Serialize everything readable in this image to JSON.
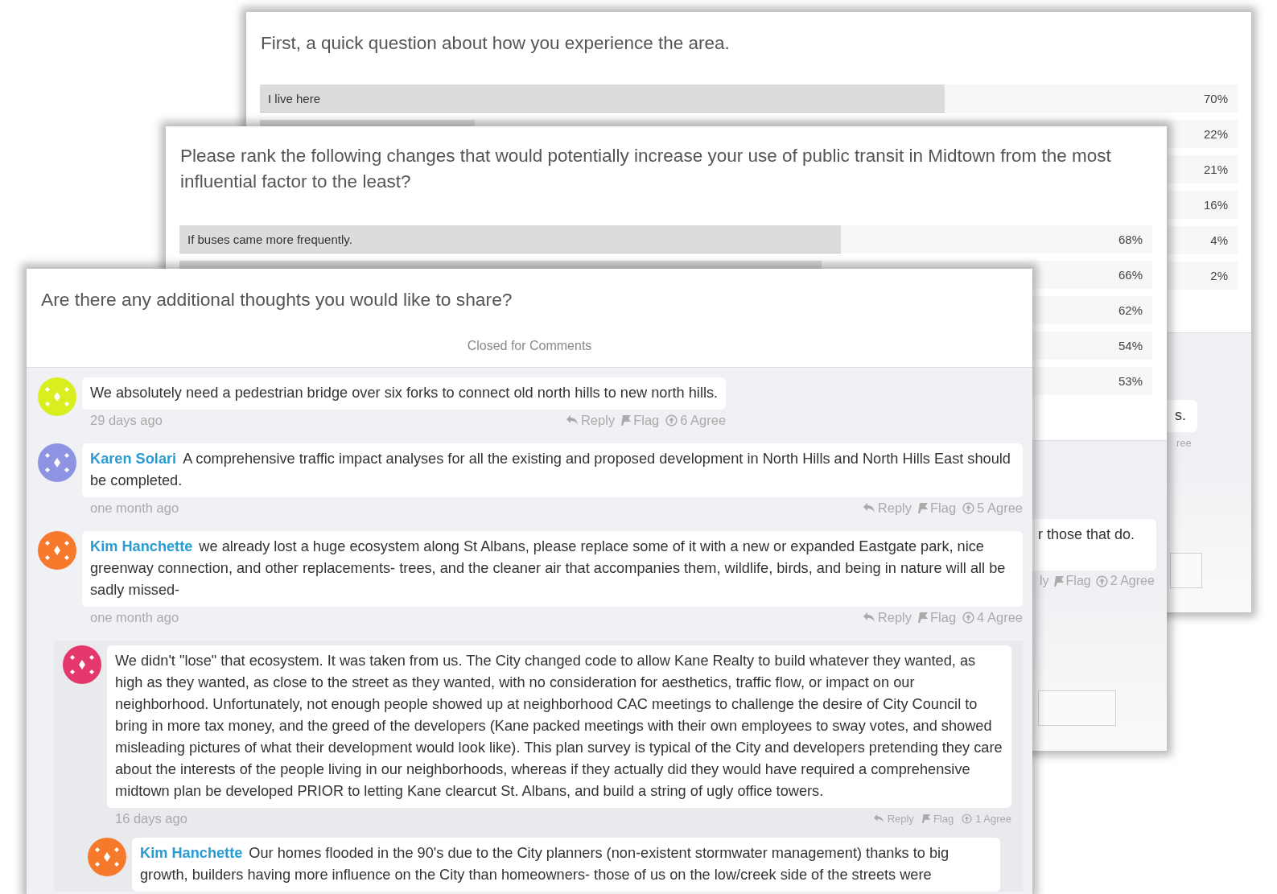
{
  "back_poll_card": {
    "question": "First, a quick question about how you experience the area.",
    "results": [
      {
        "label": "I live here",
        "level": 0.7,
        "percent": "70%"
      },
      {
        "level": 0.22,
        "percent": "22%"
      },
      {
        "percent": "21%"
      },
      {
        "percent": "16%"
      },
      {
        "percent": "4%"
      },
      {
        "percent": "2%"
      }
    ],
    "comment_fragment": {
      "text": "s.",
      "meta": "ree"
    }
  },
  "ranking_poll_card": {
    "question": "Please rank the following changes that would potentially increase your use of public transit in Midtown from the most influential factor to the least?",
    "results": [
      {
        "label": "If buses came more frequently.",
        "level": 0.68,
        "percent": "68%"
      },
      {
        "level": 0.66,
        "percent": "66%"
      },
      {
        "percent": "62%"
      },
      {
        "percent": "54%"
      },
      {
        "percent": "53%"
      }
    ],
    "comment_fragment": {
      "text": "r those that do.",
      "actions": [
        {
          "kind": "cut",
          "label": "ly"
        },
        {
          "kind": "flag",
          "label": "Flag"
        },
        {
          "kind": "agree",
          "label": "2 Agree"
        }
      ]
    }
  },
  "comments_card": {
    "question": "Are there any additional thoughts you would like to share?",
    "status": "Closed for Comments",
    "comments": [
      {
        "avatar": {
          "color": "#d9ee1f"
        },
        "text": "We absolutely need a pedestrian bridge over six forks to connect old north hills to new north hills.",
        "time": "29 days ago",
        "actions": [
          {
            "kind": "reply",
            "label": "Reply"
          },
          {
            "kind": "flag",
            "label": "Flag"
          },
          {
            "kind": "agree",
            "label": "6 Agree"
          }
        ]
      },
      {
        "avatar": {
          "color": "#8e93e2"
        },
        "author": "Karen Solari",
        "text": "A comprehensive traffic impact analyses for all the existing and proposed development in North Hills and North Hills East should be completed.",
        "time": "one month ago",
        "actions": [
          {
            "kind": "reply",
            "label": "Reply"
          },
          {
            "kind": "flag",
            "label": "Flag"
          },
          {
            "kind": "agree",
            "label": "5 Agree"
          }
        ]
      },
      {
        "avatar": {
          "color": "#f7792b"
        },
        "author": "Kim Hanchette",
        "text": "we already lost a huge ecosystem along St Albans, please replace some of it with a new or expanded Eastgate park, nice greenway connection, and other replacements- trees, and the cleaner air that accompanies them, wildlife, birds, and being in nature will all be sadly missed-",
        "time": "one month ago",
        "actions": [
          {
            "kind": "reply",
            "label": "Reply"
          },
          {
            "kind": "flag",
            "label": "Flag"
          },
          {
            "kind": "agree",
            "label": "4 Agree"
          }
        ],
        "children": [
          {
            "avatar": {
              "color": "#e4376b"
            },
            "text": "We didn't \"lose\" that ecosystem. It was taken from us. The City changed code to allow Kane Realty to build whatever they wanted, as high as they wanted, as close to the street as they wanted, with no consideration for aesthetics, traffic flow, or impact on our neighborhood. Unfortunately, not enough people showed up at neighborhood CAC meetings to challenge the desire of City Council to bring in more tax money, and the greed of the developers (Kane packed meetings with their own employees to sway votes, and showed misleading pictures of what their development would look like). This plan survey is typical of the City and developers pretending they care about the interests of the people living in our neighborhoods, whereas if they actually did they would have required a comprehensive midtown plan be developed PRIOR to letting Kane clearcut St. Albans, and build a string of ugly office towers.",
            "time": "16 days ago",
            "actions": [
              {
                "kind": "reply",
                "label": "Reply"
              },
              {
                "kind": "flag",
                "label": "Flag"
              },
              {
                "kind": "agree",
                "label": "1 Agree"
              }
            ],
            "children": [
              {
                "avatar": {
                  "color": "#f7792b"
                },
                "author": "Kim Hanchette",
                "text": "Our homes flooded in the 90's due to the City planners (non-existent stormwater management) thanks to big growth, builders having more influence on the City than homeowners- those of us on the low/creek side of the streets were"
              }
            ]
          }
        ]
      }
    ]
  }
}
